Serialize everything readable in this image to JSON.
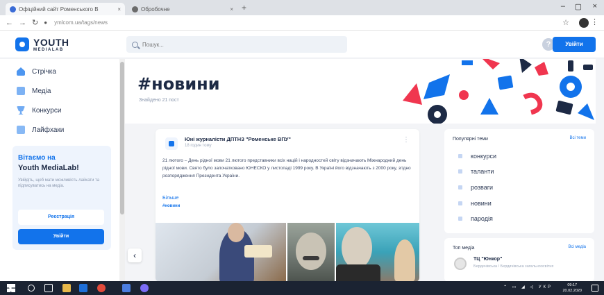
{
  "browser": {
    "tabs": [
      {
        "label": "Офіційний сайт Роменського В",
        "close": "×"
      },
      {
        "label": "Обробочне",
        "close": "×"
      }
    ],
    "new_tab": "+",
    "url": "ymlcom.ua/tags/news",
    "window_controls": [
      "–",
      "▢",
      "×"
    ]
  },
  "header": {
    "logo_title": "YOUTH",
    "logo_subtitle": "MEDIALAB",
    "search_placeholder": "Пошук...",
    "help_label": "?",
    "login_label": "Увійти"
  },
  "sidebar": {
    "items": [
      {
        "label": "Стрічка",
        "icon": "home-icon"
      },
      {
        "label": "Медіа",
        "icon": "media-icon"
      },
      {
        "label": "Конкурси",
        "icon": "trophy-icon"
      },
      {
        "label": "Лайфхаки",
        "icon": "lifehack-icon"
      }
    ],
    "welcome": {
      "title": "Вітаємо на",
      "subtitle": "Youth MediaLab!",
      "text": "Увійдіть, щоб мати можливість лайкати та підписуватись на медіа.",
      "register_label": "Реєстрація",
      "login_label": "Увійти"
    }
  },
  "hero": {
    "title": "#новини",
    "count": "Знайдено 21 пост",
    "colors": {
      "red": "#f0364f",
      "blue": "#1273eb",
      "dark": "#1d2a45"
    }
  },
  "post": {
    "author": "Юні журналісти ДПТНЗ \"Роменське ВПУ\"",
    "time": "18 годин тому",
    "body": "21 лютого – День рідної мови 21 лютого представники всіх націй і народностей світу відзначають Міжнародний день рідної мови. Свято було започатковано ЮНЕСКО у листопаді 1999 року. В Україні його відзначають з 2000 року, згідно розпорядження Президента України.",
    "more": "Більше",
    "tag": "#новини",
    "menu": "⋮"
  },
  "prev_arrow": "‹",
  "popular_topics": {
    "title": "Популярні теми",
    "link": "Всі теми",
    "items": [
      "конкурси",
      "таланти",
      "розваги",
      "новини",
      "пародія"
    ]
  },
  "top_media": {
    "title": "Топ медіа",
    "link": "Всі медіа",
    "name": "ТЦ \"Юнкор\"",
    "subtitle": "Бердичівська / Бердичівська загальноосвітня"
  },
  "taskbar": {
    "time": "09:17",
    "date": "20.02.2020",
    "lang": "УКР"
  }
}
